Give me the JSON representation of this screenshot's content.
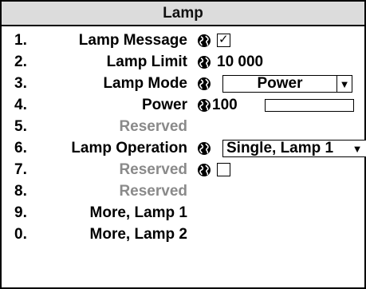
{
  "menu": {
    "title": "Lamp",
    "rows": [
      {
        "num": "1.",
        "label": "Lamp Message",
        "globe_icon": "globe-icon",
        "checkbox_checked": true,
        "check_mark": "✓"
      },
      {
        "num": "2.",
        "label": "Lamp Limit",
        "globe_icon": "globe-icon",
        "value": "10 000"
      },
      {
        "num": "3.",
        "label": "Lamp Mode",
        "globe_icon": "globe-icon",
        "selected": "Power",
        "arrow": "▼"
      },
      {
        "num": "4.",
        "label": "Power",
        "globe_icon": "globe-icon",
        "value": "100",
        "slider_level": 0
      },
      {
        "num": "5.",
        "label": "Reserved"
      },
      {
        "num": "6.",
        "label": "Lamp Operation",
        "globe_icon": "globe-icon",
        "selected": "Single, Lamp 1",
        "arrow": "▼"
      },
      {
        "num": "7.",
        "label": "Reserved",
        "globe_icon": "globe-icon",
        "checkbox_checked": false
      },
      {
        "num": "8.",
        "label": "Reserved"
      },
      {
        "num": "9.",
        "label": "More, Lamp 1"
      },
      {
        "num": "0.",
        "label": "More, Lamp 2"
      }
    ]
  },
  "colors": {
    "title_background": "#dcdcdc",
    "disabled_text": "#8a8a8a",
    "border": "#000000"
  }
}
